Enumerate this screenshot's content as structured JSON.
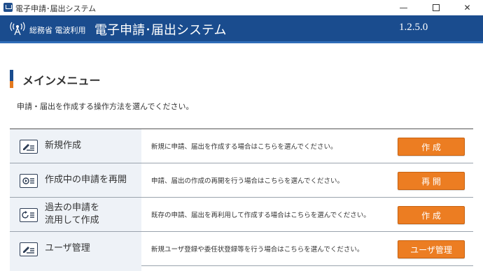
{
  "window": {
    "title": "電子申請･届出システム",
    "minimize": "—",
    "close": "✕"
  },
  "header": {
    "ministry": "総務省 電波利用",
    "system_title": "電子申請･届出システム",
    "version": "1.2.5.0"
  },
  "main": {
    "heading": "メインメニュー",
    "instruction": "申請・届出を作成する操作方法を選んでください。",
    "rows": [
      {
        "label": "新規作成",
        "description": "新規に申請、届出を作成する場合はこちらを選んでください。",
        "button": "作 成",
        "icon": "new-document-icon"
      },
      {
        "label": "作成中の申請を再開",
        "description": "申請、届出の作成の再開を行う場合はこちらを選んでください。",
        "button": "再 開",
        "icon": "resume-document-icon"
      },
      {
        "label_line1": "過去の申請を",
        "label_line2": "流用して作成",
        "description": "既存の申請、届出を再利用して作成する場合はこちらを選んでください。",
        "button": "作 成",
        "icon": "reuse-document-icon"
      },
      {
        "label": "ユーザ管理",
        "description": "新規ユーザ登録や委任状登録等を行う場合はこちらを選んでください。",
        "button": "ユーザ管理",
        "icon": "user-management-icon"
      }
    ]
  },
  "colors": {
    "header_blue": "#1a4c8e",
    "accent_orange": "#ec7d22",
    "row_label_bg": "#eef2f7"
  }
}
